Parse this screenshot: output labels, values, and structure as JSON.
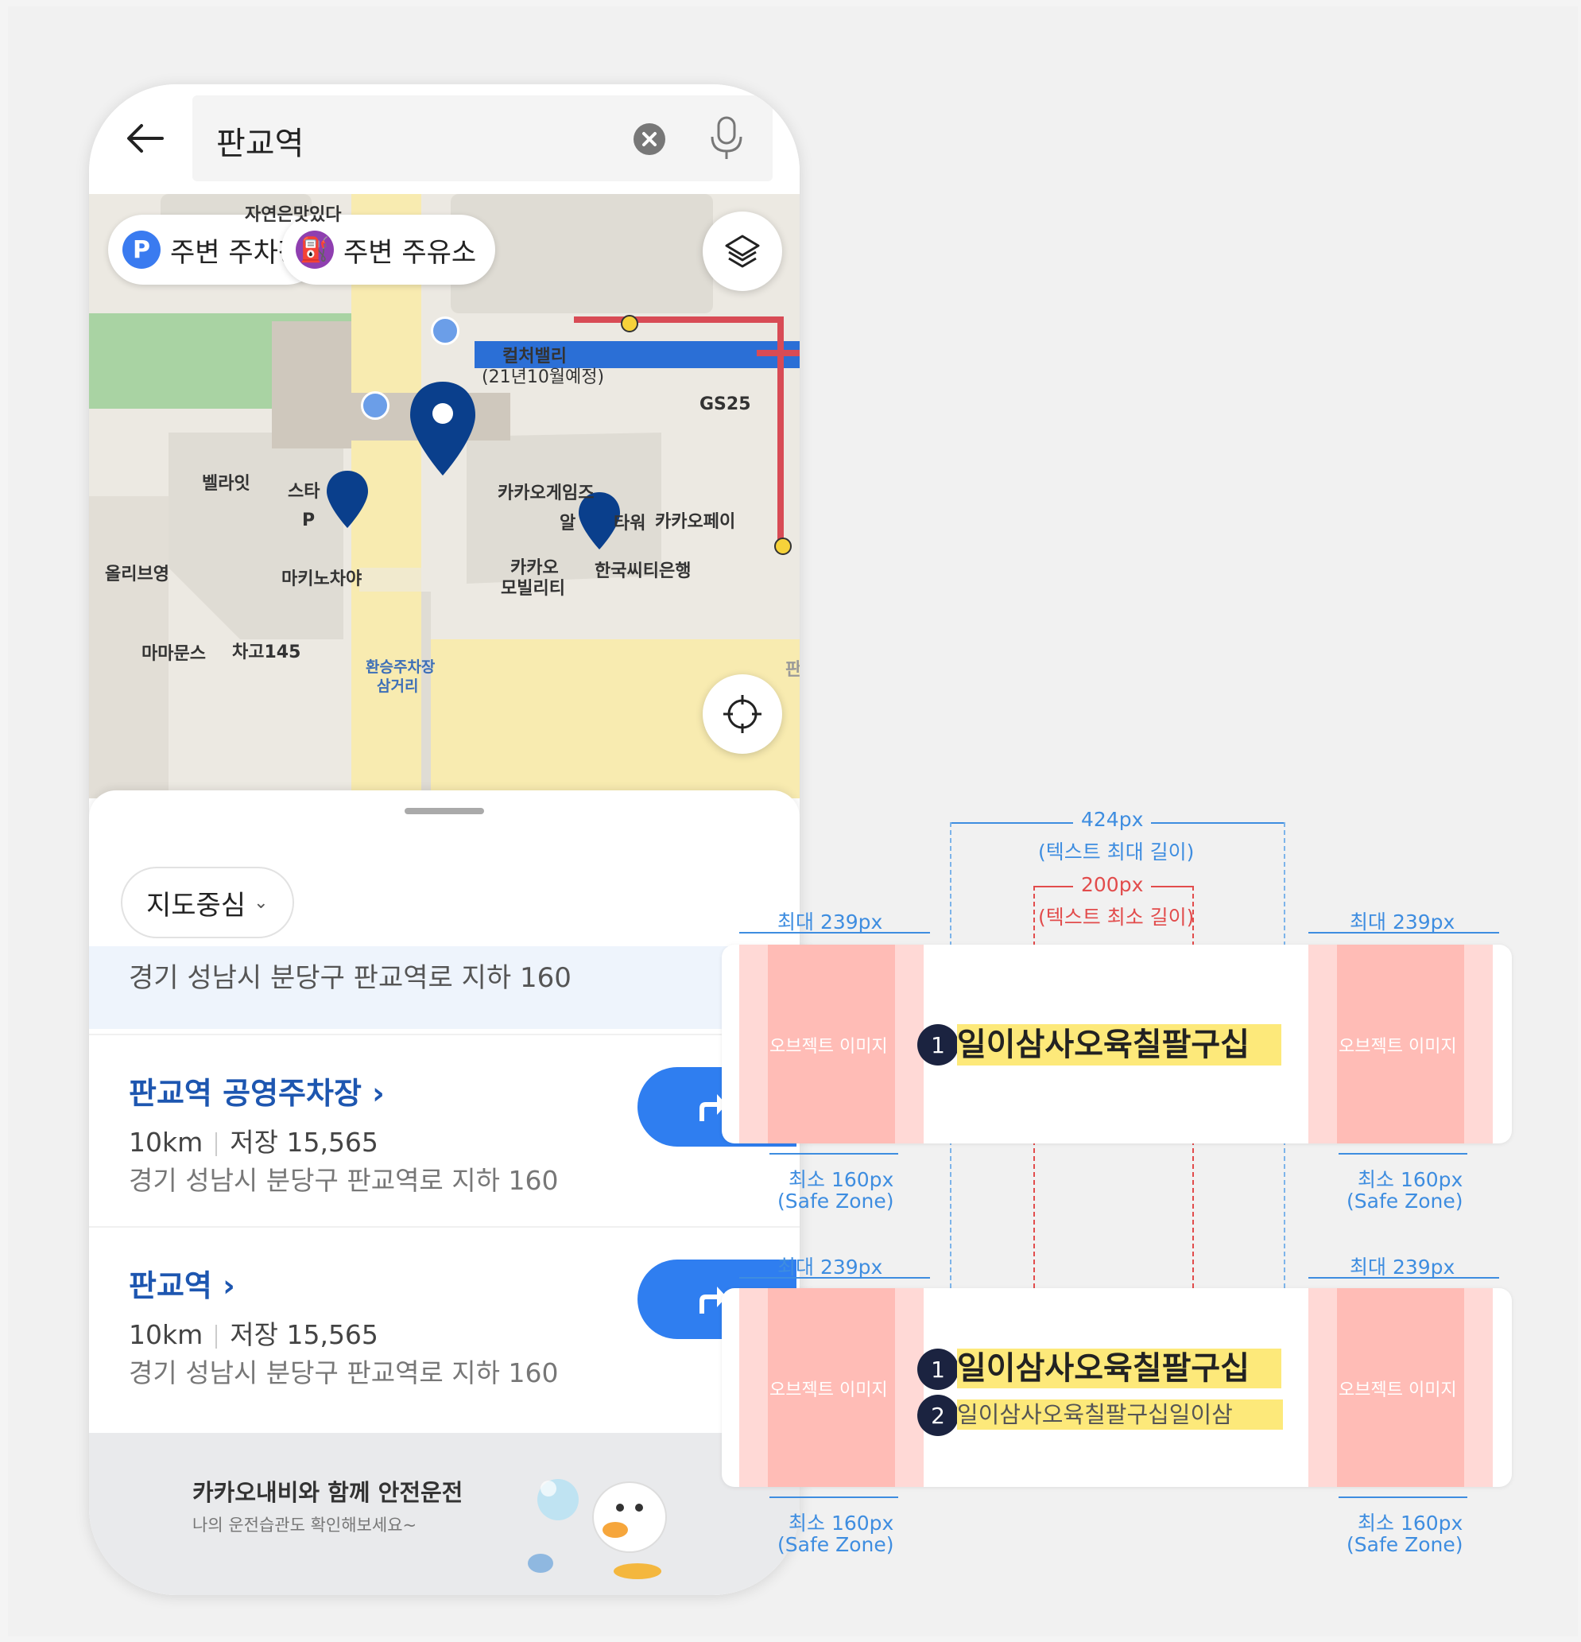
{
  "search": {
    "query": "판교역"
  },
  "map": {
    "chips": [
      {
        "icon": "P",
        "label": "주변 주차장",
        "color": "#3a7bf0"
      },
      {
        "icon": "⛽",
        "label": "주변 주유소",
        "color": "#8f3fb0"
      }
    ],
    "pois": {
      "top_label": "자연은맛있다",
      "culture_valley": "컬처밸리",
      "culture_valley_sub": "(21년10월예정)",
      "gs25": "GS25",
      "bellite": "벨라잇",
      "star": "스타",
      "kakao_games": "카카오게임즈",
      "alpha_tower_a": "알",
      "alpha_tower_b": "타워",
      "kakao_pay": "카카오페이",
      "kakao_mobility_1": "카카오",
      "kakao_mobility_2": "모빌리티",
      "citibank": "한국씨티은행",
      "olive": "올리브영",
      "makino": "마키노차야",
      "mamamoons": "마마문스",
      "chago": "차고145",
      "transfer_1": "환승주차장",
      "transfer_2": "삼거리",
      "p_marker": "P",
      "stn_sign": "판"
    }
  },
  "sheet": {
    "filter_label": "지도중심",
    "highlight_address": "경기 성남시 분당구 판교역로 지하 160",
    "results": [
      {
        "name": "판교역 공영주차장 ›",
        "distance": "10km",
        "saved": "저장 15,565",
        "address": "경기 성남시 분당구 판교역로 지하 160"
      },
      {
        "name": "판교역 ›",
        "distance": "10km",
        "saved": "저장 15,565",
        "address": "경기 성남시 분당구 판교역로 지하 160"
      }
    ],
    "banner": {
      "title": "카카오내비와 함께 안전운전",
      "subtitle": "나의 운전습관도 확인해보세요~"
    }
  },
  "spec": {
    "max_text_width": "424px",
    "max_text_caption": "(텍스트 최대 길이)",
    "min_text_width": "200px",
    "min_text_caption": "(텍스트 최소 길이)",
    "side_max": "최대 239px",
    "safe_min": "최소 160px",
    "safe_caption": "(Safe Zone)",
    "object_image": "오브젝트 이미지",
    "badge_1": "1",
    "badge_2": "2",
    "line_1": "일이삼사오육칠팔구십",
    "line_2": "일이삼사오육칠팔구십일이삼"
  },
  "colors": {
    "brand_blue": "#2f7ef0",
    "name_blue": "#1d56b0",
    "marker_navy": "#0a3f8c",
    "spec_blue": "#3e8de0",
    "spec_red": "#e24c4c",
    "highlight_yellow": "#fde97a",
    "safe_zone_pink": "#ffbcb6"
  }
}
